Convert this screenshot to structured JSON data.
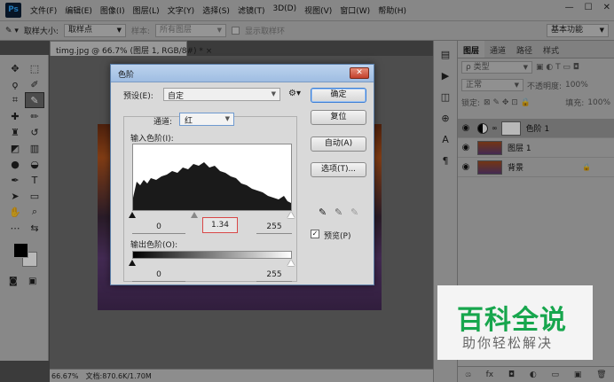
{
  "app": {
    "logo": "Ps",
    "menu": [
      "文件(F)",
      "编辑(E)",
      "图像(I)",
      "图层(L)",
      "文字(Y)",
      "选择(S)",
      "滤镜(T)",
      "3D(D)",
      "视图(V)",
      "窗口(W)",
      "帮助(H)"
    ],
    "window_buttons": [
      "—",
      "☐",
      "✕"
    ]
  },
  "options_bar": {
    "sample_size_label": "取样大小:",
    "sample_size_value": "取样点",
    "sample_label": "样本:",
    "sample_value": "所有图层",
    "show_ring_label": "显示取样环",
    "workspace_value": "基本功能"
  },
  "document": {
    "tab_title": "timg.jpg @ 66.7% (图层 1, RGB/8#) *",
    "zoom": "66.67%",
    "doc_size": "文档:870.6K/1.70M"
  },
  "layers_panel": {
    "tabs": [
      "图层",
      "通道",
      "路径",
      "样式"
    ],
    "filter_value": "ρ 类型",
    "blend_mode": "正常",
    "opacity_label": "不透明度:",
    "opacity_value": "100%",
    "lock_label": "锁定:",
    "fill_label": "填充:",
    "fill_value": "100%",
    "layers": [
      {
        "name": "色阶 1",
        "kind": "adjustment",
        "active": true
      },
      {
        "name": "图层 1",
        "kind": "pixel",
        "active": false
      },
      {
        "name": "背景",
        "kind": "background",
        "active": false,
        "locked": true
      }
    ],
    "footer_icons": [
      "ශ",
      "fx",
      "◘",
      "◐",
      "▭",
      "▣",
      "🗑"
    ]
  },
  "watermark": {
    "title": "百科全说",
    "subtitle": "助你轻松解决"
  },
  "levels_dialog": {
    "title": "色阶",
    "close": "✕",
    "preset_label": "预设(E):",
    "preset_value": "自定",
    "channel_label": "通道:",
    "channel_value": "红",
    "input_label": "输入色阶(I):",
    "input_black": "0",
    "input_gamma": "1.34",
    "input_white": "255",
    "output_label": "输出色阶(O):",
    "output_black": "0",
    "output_white": "255",
    "buttons": {
      "ok": "确定",
      "reset": "复位",
      "auto": "自动(A)",
      "options": "选项(T)..."
    },
    "preview_label": "预览(P)",
    "preview_checked": true
  },
  "colors": {
    "accent_green": "#17a64d",
    "highlight_red": "#d84848"
  }
}
